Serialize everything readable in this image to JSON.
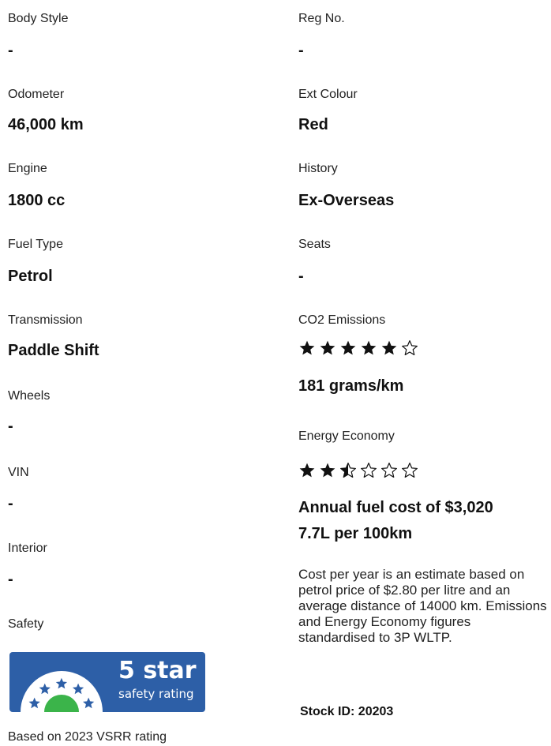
{
  "left": {
    "body_style_label": "Body Style",
    "body_style_value": "-",
    "odometer_label": "Odometer",
    "odometer_value": "46,000 km",
    "engine_label": "Engine",
    "engine_value": "1800 cc",
    "fuel_type_label": "Fuel Type",
    "fuel_type_value": "Petrol",
    "transmission_label": "Transmission",
    "transmission_value": "Paddle Shift",
    "wheels_label": "Wheels",
    "wheels_value": "-",
    "vin_label": "VIN",
    "vin_value": "-",
    "interior_label": "Interior",
    "interior_value": "-",
    "safety_label": "Safety",
    "safety_badge_line1": "5 star",
    "safety_badge_line2": "safety rating",
    "safety_stars": 5,
    "safety_footnote": "Based on 2023 VSRR rating"
  },
  "right": {
    "reg_label": "Reg No.",
    "reg_value": "-",
    "ext_colour_label": "Ext Colour",
    "ext_colour_value": "Red",
    "history_label": "History",
    "history_value": "Ex-Overseas",
    "seats_label": "Seats",
    "seats_value": "-",
    "co2_label": "CO2 Emissions",
    "co2_rating": 5,
    "co2_rating_max": 6,
    "co2_value": "181 grams/km",
    "energy_label": "Energy Economy",
    "energy_rating": 2.5,
    "energy_rating_max": 6,
    "annual_cost": "Annual fuel cost of $3,020",
    "consumption": "7.7L per 100km",
    "note": "Cost per year is an estimate based on petrol price of  $2.80 per litre and an average distance of 14000 km. Emissions and Energy Economy figures standardised to 3P WLTP.",
    "stock_id": "Stock ID: 20203"
  },
  "colors": {
    "badge_blue": "#2d5fa7",
    "badge_green": "#3bb44a",
    "star_black": "#111111"
  }
}
